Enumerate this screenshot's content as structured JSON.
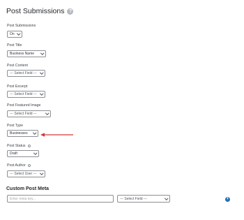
{
  "header": {
    "title": "Post Submissions",
    "help_icon": "help-circle-icon"
  },
  "fields": {
    "post_submissions": {
      "label": "Post Submissions",
      "value": "On"
    },
    "post_title": {
      "label": "Post Title",
      "value": "Business Name"
    },
    "post_content": {
      "label": "Post Content",
      "value": "--- Select Field ---"
    },
    "post_excerpt": {
      "label": "Post Excerpt",
      "value": "--- Select Field ---"
    },
    "post_featured_image": {
      "label": "Post Featured Image",
      "value": "--- Select Field ---"
    },
    "post_type": {
      "label": "Post Type",
      "value": "Businesses"
    },
    "post_status": {
      "label": "Post Status",
      "value": "Draft"
    },
    "post_author": {
      "label": "Post Author",
      "value": "--- Select User ---"
    }
  },
  "custom_meta": {
    "title": "Custom Post Meta",
    "key_placeholder": "Enter meta key...",
    "field_value": "--- Select Field ---",
    "add_icon": "plus-circle-icon"
  },
  "colors": {
    "annotation_arrow": "#d63638",
    "accent": "#2271b1"
  }
}
